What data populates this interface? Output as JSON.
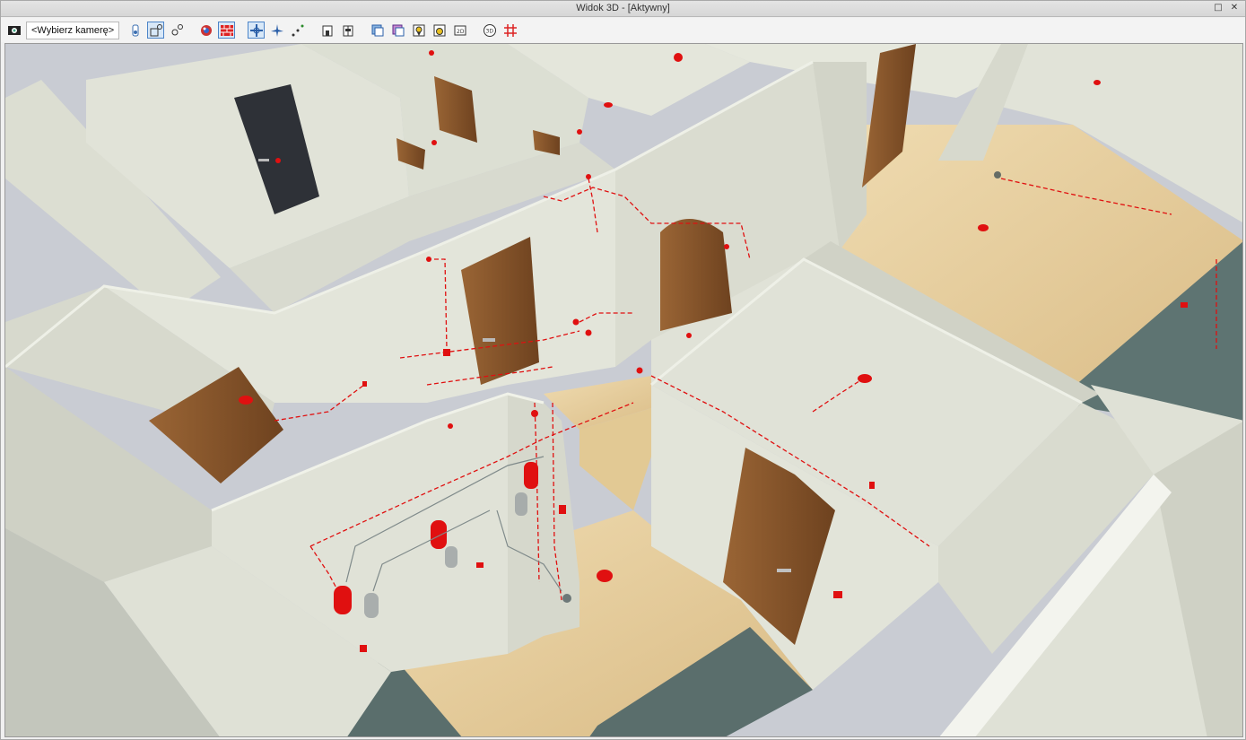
{
  "window": {
    "title": "Widok 3D - [Aktywny]",
    "buttons": [
      "□",
      "✕"
    ]
  },
  "toolbar": {
    "camera_select": "<Wybierz kamerę>",
    "icons": [
      "camera-icon",
      "walk-person-icon",
      "orbit-icon",
      "zoom-extents-icon",
      "render-icon",
      "wall-grid-icon",
      "pan-icon",
      "fly-icon",
      "path-icon",
      "building-front-icon",
      "building-section-icon",
      "layers-icon",
      "layers2-icon",
      "sun-icon",
      "camera-capture-icon",
      "export-2d-icon",
      "export-3d-icon",
      "grid-red-icon"
    ]
  },
  "colors": {
    "wall": "#dfe1d6",
    "wall_shade": "#c9ccc1",
    "floor_wood": "#e8cf9f",
    "floor_dark": "#5a6e6c",
    "door_wood": "#8b5a2e",
    "door_dark": "#2d3035",
    "red": "#e01010",
    "background": "#c9ccd3"
  }
}
